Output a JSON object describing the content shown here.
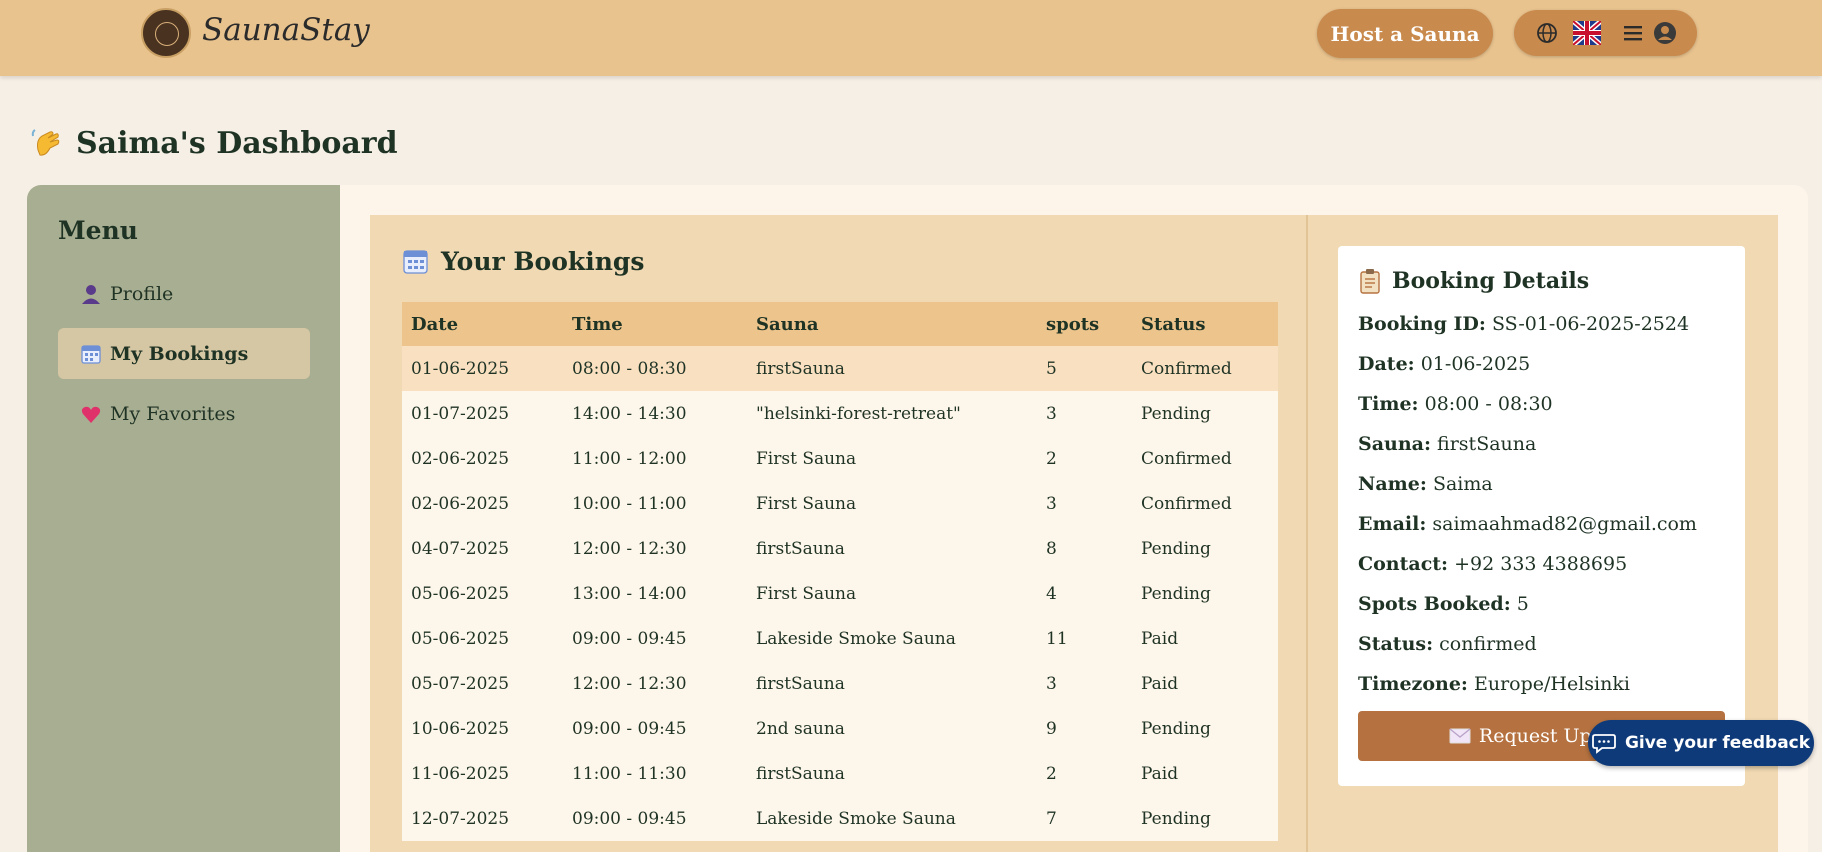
{
  "header": {
    "brand": "SaunaStay",
    "host_button": "Host a Sauna",
    "icons": [
      "globe-icon",
      "uk-flag-icon",
      "menu-icon",
      "account-icon"
    ]
  },
  "dashboard": {
    "title": "Saima's Dashboard",
    "icon": "waving-hand-icon"
  },
  "sidebar": {
    "title": "Menu",
    "items": [
      {
        "label": "Profile",
        "icon": "person-icon",
        "active": false
      },
      {
        "label": "My Bookings",
        "icon": "calendar-icon",
        "active": true
      },
      {
        "label": "My Favorites",
        "icon": "heart-icon",
        "active": false
      }
    ]
  },
  "bookings": {
    "title": "Your Bookings",
    "columns": [
      "Date",
      "Time",
      "Sauna",
      "spots",
      "Status"
    ],
    "rows": [
      [
        "01-06-2025",
        "08:00 - 08:30",
        "firstSauna",
        "5",
        "Confirmed"
      ],
      [
        "01-07-2025",
        "14:00 - 14:30",
        "\"helsinki-forest-retreat\"",
        "3",
        "Pending"
      ],
      [
        "02-06-2025",
        "11:00 - 12:00",
        "First Sauna",
        "2",
        "Confirmed"
      ],
      [
        "02-06-2025",
        "10:00 - 11:00",
        "First Sauna",
        "3",
        "Confirmed"
      ],
      [
        "04-07-2025",
        "12:00 - 12:30",
        "firstSauna",
        "8",
        "Pending"
      ],
      [
        "05-06-2025",
        "13:00 - 14:00",
        "First Sauna",
        "4",
        "Pending"
      ],
      [
        "05-06-2025",
        "09:00 - 09:45",
        "Lakeside Smoke Sauna",
        "11",
        "Paid"
      ],
      [
        "05-07-2025",
        "12:00 - 12:30",
        "firstSauna",
        "3",
        "Paid"
      ],
      [
        "10-06-2025",
        "09:00 - 09:45",
        "2nd sauna",
        "9",
        "Pending"
      ],
      [
        "11-06-2025",
        "11:00 - 11:30",
        "firstSauna",
        "2",
        "Paid"
      ],
      [
        "12-07-2025",
        "09:00 - 09:45",
        "Lakeside Smoke Sauna",
        "7",
        "Pending"
      ]
    ]
  },
  "details": {
    "title": "Booking Details",
    "fields": [
      {
        "label": "Booking ID:",
        "value": "SS-01-06-2025-2524"
      },
      {
        "label": "Date:",
        "value": "01-06-2025"
      },
      {
        "label": "Time:",
        "value": "08:00 - 08:30"
      },
      {
        "label": "Sauna:",
        "value": "firstSauna"
      },
      {
        "label": "Name:",
        "value": "Saima"
      },
      {
        "label": "Email:",
        "value": "saimaahmad82@gmail.com"
      },
      {
        "label": "Contact:",
        "value": "+92 333 4388695"
      },
      {
        "label": "Spots Booked:",
        "value": "5"
      },
      {
        "label": "Status:",
        "value": "confirmed"
      },
      {
        "label": "Timezone:",
        "value": "Europe/Helsinki"
      }
    ],
    "button": "Request Update"
  },
  "feedback": {
    "label": "Give your feedback"
  }
}
